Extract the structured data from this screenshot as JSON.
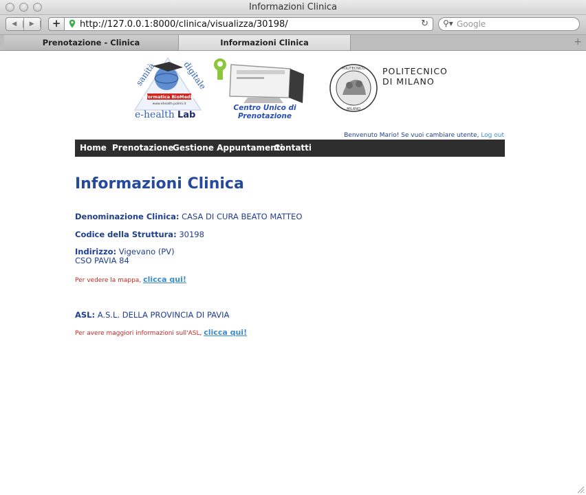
{
  "window": {
    "title": "Informazioni Clinica"
  },
  "browser": {
    "url": "http://127.0.0.1:8000/clinica/visualizza/30198/",
    "search_placeholder": "Google",
    "tabs": [
      {
        "label": "Prenotazione - Clinica"
      },
      {
        "label": "Informazioni Clinica"
      }
    ]
  },
  "header": {
    "ehealth_logo": {
      "arc_left": "sanità",
      "arc_right": "digitale",
      "band": "Informatica BioMedica",
      "site": "www.ehealth.polimi.it",
      "name_a": "e-health",
      "name_b": "Lab"
    },
    "cup_logo": {
      "line1": "Centro Unico di",
      "line2": "Prenotazione"
    },
    "polimi_logo": {
      "line1": "POLITECNICO",
      "line2": "DI MILANO",
      "seal_top": "POLITECNICO",
      "seal_bottom": "MILANO"
    },
    "welcome_text": "Benvenuto Mario! Se vuoi cambiare utente,",
    "logout_label": "Log out"
  },
  "menu": [
    "Home",
    "Prenotazione",
    "Gestione Appuntamenti",
    "Contatti"
  ],
  "page": {
    "title": "Informazioni Clinica",
    "denominazione": {
      "label": "Denominazione Clinica:",
      "value": "CASA DI CURA BEATO MATTEO"
    },
    "codice": {
      "label": "Codice della Struttura:",
      "value": "30198"
    },
    "indirizzo": {
      "label": "Indirizzo:",
      "value": "Vigevano (PV)",
      "line2": "CSO PAVIA 84"
    },
    "mappa_note": {
      "text": "Per vedere la mappa,",
      "link": "clicca qui!"
    },
    "asl": {
      "label": "ASL:",
      "value": "A.S.L. DELLA PROVINCIA DI PAVIA"
    },
    "asl_note": {
      "text": "Per avere maggiori informazioni sull'ASL,",
      "link": "clicca qui!"
    }
  },
  "colors": {
    "heading": "#254a9c",
    "text": "#1f3e8f",
    "note": "#c5281e",
    "link": "#3a8bd1",
    "menubar": "#2e2e2e"
  }
}
